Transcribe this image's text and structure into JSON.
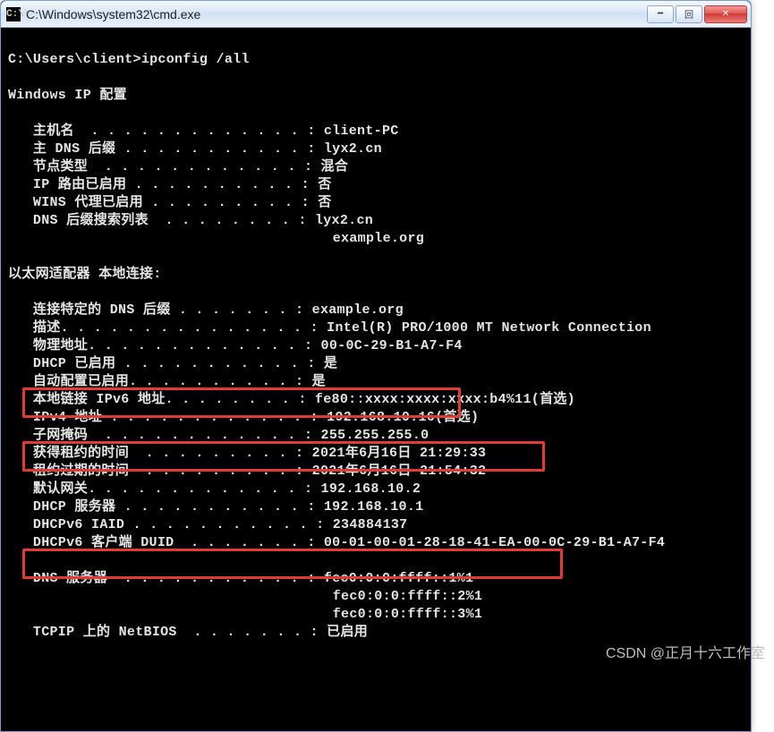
{
  "window": {
    "title": "C:\\Windows\\system32\\cmd.exe",
    "minimize": "━",
    "maximize": "回",
    "close": "✕"
  },
  "prompt": "C:\\Users\\client>ipconfig /all",
  "section_ip_config": "Windows IP 配置",
  "ip_config_lines": {
    "hostname": "   主机名  . . . . . . . . . . . . . : client-PC",
    "primary_dns": "   主 DNS 后缀 . . . . . . . . . . . : lyx2.cn",
    "node_type": "   节点类型  . . . . . . . . . . . . : 混合",
    "ip_routing": "   IP 路由已启用 . . . . . . . . . . : 否",
    "wins_proxy": "   WINS 代理已启用 . . . . . . . . . : 否",
    "dns_suffix_l": "   DNS 后缀搜索列表  . . . . . . . . : lyx2.cn",
    "dns_suffix_2": "                                       example.org"
  },
  "section_adapter": "以太网适配器 本地连接:",
  "adapter_lines": {
    "conn_suffix": "   连接特定的 DNS 后缀 . . . . . . . : example.org",
    "description": "   描述. . . . . . . . . . . . . . . : Intel(R) PRO/1000 MT Network Connection",
    "physical_addr": "   物理地址. . . . . . . . . . . . . : 00-0C-29-B1-A7-F4",
    "dhcp_enabled": "   DHCP 已启用 . . . . . . . . . . . : 是",
    "autoconfig": "   自动配置已启用. . . . . . . . . . : 是",
    "linklocal": "   本地链接 IPv6 地址. . . . . . . . : fe80::xxxx:xxxx:xxxx:b4%11(首选)",
    "ipv4": "   IPv4 地址 . . . . . . . . . . . . : 192.168.10.16(首选)",
    "subnet": "   子网掩码  . . . . . . . . . . . . : 255.255.255.0",
    "lease_obt": "   获得租约的时间  . . . . . . . . . : 2021年6月16日 21:29:33",
    "lease_exp": "   租约过期的时间  . . . . . . . . . : 2021年6月16日 21:54:32",
    "def_gateway": "   默认网关. . . . . . . . . . . . . : 192.168.10.2",
    "dhcp_server": "   DHCP 服务器 . . . . . . . . . . . : 192.168.10.1",
    "dhcpv6_iaid": "   DHCPv6 IAID . . . . . . . . . . . : 234884137",
    "dhcpv6_duid": "   DHCPv6 客户端 DUID  . . . . . . . : 00-01-00-01-28-18-41-EA-00-0C-29-B1-A7-F4",
    "blank": "",
    "dns_servers": "   DNS 服务器  . . . . . . . . . . . : fec0:0:0:ffff::1%1",
    "dns_servers2": "                                       fec0:0:0:ffff::2%1",
    "dns_servers3": "                                       fec0:0:0:ffff::3%1",
    "tcpip_netbios": "   TCPIP 上的 NetBIOS  . . . . . . . : 已启用"
  },
  "watermark": "CSDN @正月十六工作室"
}
